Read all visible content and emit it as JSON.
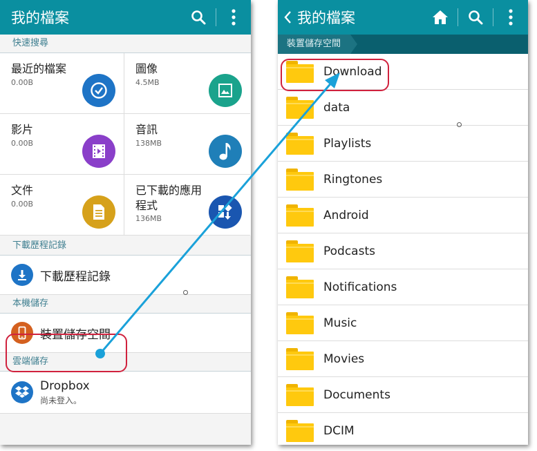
{
  "left": {
    "title": "我的檔案",
    "quick_search": {
      "header": "快速搜尋",
      "tiles": [
        {
          "name": "最近的檔案",
          "size": "0.00B",
          "icon": "recent-clock-icon",
          "color": "#1e74c6"
        },
        {
          "name": "圖像",
          "size": "4.5MB",
          "icon": "image-icon",
          "color": "#1aa38c"
        },
        {
          "name": "影片",
          "size": "0.00B",
          "icon": "video-icon",
          "color": "#8a3fc9"
        },
        {
          "name": "音訊",
          "size": "138MB",
          "icon": "music-note-icon",
          "color": "#1f7fb8"
        },
        {
          "name": "文件",
          "size": "0.00B",
          "icon": "document-icon",
          "color": "#d6a11b"
        },
        {
          "name": "已下載的應用程式",
          "size": "136MB",
          "icon": "downloaded-apps-icon",
          "color": "#1a56b0"
        }
      ]
    },
    "download_history": {
      "header": "下載歷程記錄",
      "item": "下載歷程記錄"
    },
    "local_storage": {
      "header": "本機儲存",
      "item": "裝置儲存空間"
    },
    "cloud_storage": {
      "header": "雲端儲存",
      "item": "Dropbox",
      "sub": "尚未登入。"
    }
  },
  "right": {
    "title": "我的檔案",
    "breadcrumb": "裝置儲存空間",
    "folders": [
      "Download",
      "data",
      "Playlists",
      "Ringtones",
      "Android",
      "Podcasts",
      "Notifications",
      "Music",
      "Movies",
      "Documents",
      "DCIM"
    ]
  },
  "colors": {
    "appbar": "#0a8fa0",
    "highlight": "#d0213d",
    "arrow": "#1aa1d9",
    "folder": "#ffc90e"
  }
}
